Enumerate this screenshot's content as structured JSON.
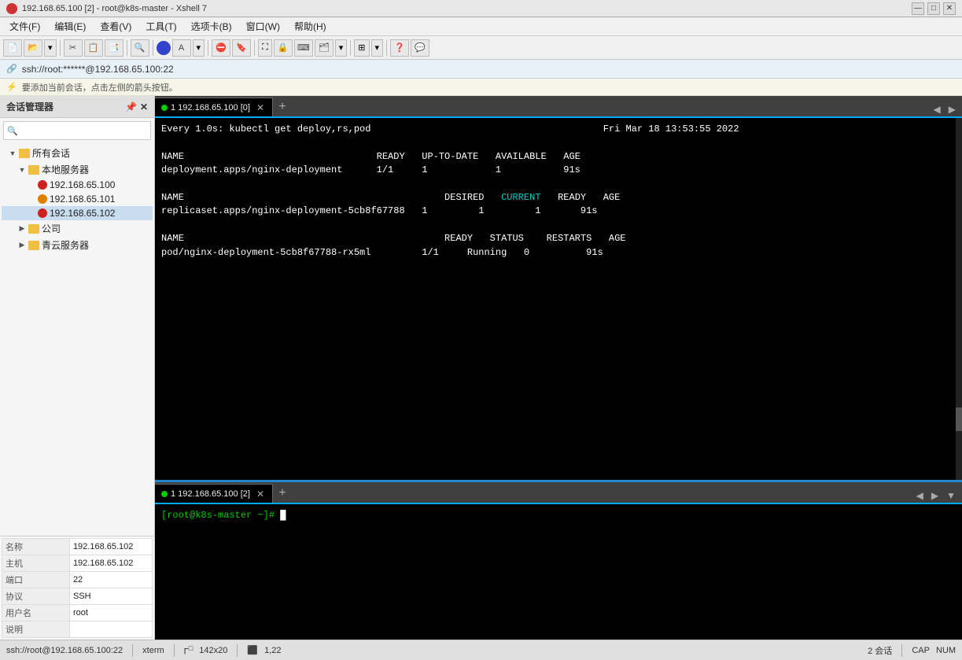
{
  "titleBar": {
    "text": "192.168.65.100 [2] - root@k8s-master - Xshell 7",
    "icon": "xshell-icon",
    "buttons": [
      "minimize",
      "maximize",
      "close"
    ]
  },
  "menuBar": {
    "items": [
      "文件(F)",
      "编辑(E)",
      "查看(V)",
      "工具(T)",
      "选项卡(B)",
      "窗口(W)",
      "帮助(H)"
    ]
  },
  "addressBar": {
    "text": "ssh://root:******@192.168.65.100:22"
  },
  "hintBar": {
    "text": "要添加当前会话，点击左侧的箭头按钮。"
  },
  "sidebar": {
    "title": "会话管理器",
    "searchPlaceholder": "",
    "tree": [
      {
        "label": "所有会话",
        "level": 1,
        "type": "folder",
        "expanded": true
      },
      {
        "label": "本地服务器",
        "level": 2,
        "type": "folder",
        "expanded": true
      },
      {
        "label": "192.168.65.100",
        "level": 3,
        "type": "server-red"
      },
      {
        "label": "192.168.65.101",
        "level": 3,
        "type": "server-orange"
      },
      {
        "label": "192.168.65.102",
        "level": 3,
        "type": "server-red",
        "selected": true
      },
      {
        "label": "公司",
        "level": 2,
        "type": "folder",
        "expanded": false
      },
      {
        "label": "青云服务器",
        "level": 2,
        "type": "folder",
        "expanded": false
      }
    ]
  },
  "sessionInfo": {
    "rows": [
      {
        "label": "名称",
        "value": "192.168.65.102"
      },
      {
        "label": "主机",
        "value": "192.168.65.102"
      },
      {
        "label": "端口",
        "value": "22"
      },
      {
        "label": "协议",
        "value": "SSH"
      },
      {
        "label": "用户名",
        "value": "root"
      },
      {
        "label": "说明",
        "value": ""
      }
    ]
  },
  "terminalTop": {
    "tab": {
      "label": "1 192.168.65.100 [0]",
      "active": true
    },
    "content": {
      "commandLine": "Every 1.0s: kubectl get deploy,rs,pod                                         Fri Mar 18 13:53:55 2022",
      "table1Header": "NAME                                  READY   UP-TO-DATE   AVAILABLE   AGE",
      "table1Row1": "deployment.apps/nginx-deployment      1/1     1            1           91s",
      "table2Header": "NAME                                              DESIRED   CURRENT   READY   AGE",
      "table2Row1": "replicaset.apps/nginx-deployment-5cb8f67788   1         1         1       91s",
      "table3Header": "NAME                                              READY   STATUS    RESTARTS   AGE",
      "table3Row1": "pod/nginx-deployment-5cb8f67788-rx5ml         1/1     Running   0          91s"
    }
  },
  "terminalBottom": {
    "tab": {
      "label": "1 192.168.65.100 [2]",
      "active": true
    },
    "content": {
      "prompt": "[root@k8s-master ~]# "
    }
  },
  "statusBar": {
    "ssh": "ssh://root@192.168.65.100:22",
    "termType": "xterm",
    "dimensions": "142x20",
    "cursor": "1,22",
    "sessions": "2 会话",
    "caps": "CAP",
    "num": "NUM"
  }
}
